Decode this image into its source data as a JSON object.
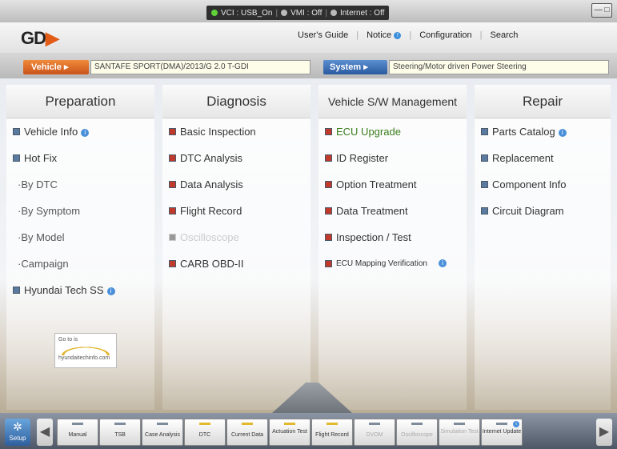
{
  "status": {
    "vci": "VCI : USB_On",
    "vmi": "VMI : Off",
    "internet": "Internet : Off"
  },
  "header": {
    "logo_left": "GD",
    "nav": [
      "User's Guide",
      "Notice",
      "Configuration",
      "Search"
    ]
  },
  "infobar": {
    "vehicle_label": "Vehicle",
    "vehicle_value": "SANTAFE SPORT(DMA)/2013/G 2.0 T-GDI",
    "system_label": "System",
    "system_value": "Steering/Motor driven Power Steering"
  },
  "columns": {
    "preparation": {
      "title": "Preparation",
      "items": [
        "Vehicle Info",
        "Hot Fix",
        "By DTC",
        "By Symptom",
        "By Model",
        "Campaign",
        "Hyundai Tech SS"
      ]
    },
    "diagnosis": {
      "title": "Diagnosis",
      "items": [
        "Basic Inspection",
        "DTC Analysis",
        "Data Analysis",
        "Flight Record",
        "Oscilloscope",
        "CARB OBD-II"
      ]
    },
    "swm": {
      "title": "Vehicle S/W Management",
      "items": [
        "ECU Upgrade",
        "ID Register",
        "Option Treatment",
        "Data Treatment",
        "Inspection / Test",
        "ECU Mapping Verification"
      ]
    },
    "repair": {
      "title": "Repair",
      "items": [
        "Parts Catalog",
        "Replacement",
        "Component Info",
        "Circuit Diagram"
      ]
    }
  },
  "tech_link": {
    "goto": "Go to is",
    "site": "hyundaitechinfo.com"
  },
  "toolbar": {
    "setup": "Setup",
    "tools": [
      "Manual",
      "TSB",
      "Case Analysis",
      "DTC",
      "Current Data",
      "Actuation Test",
      "Flight Record",
      "DVOM",
      "Oscilloscope",
      "Simulation Test",
      "Internet Update"
    ]
  },
  "colors": {
    "vehicle_orange": "#e06a22",
    "system_blue": "#3b6fb6",
    "highlight_green": "#3a7d1c"
  }
}
